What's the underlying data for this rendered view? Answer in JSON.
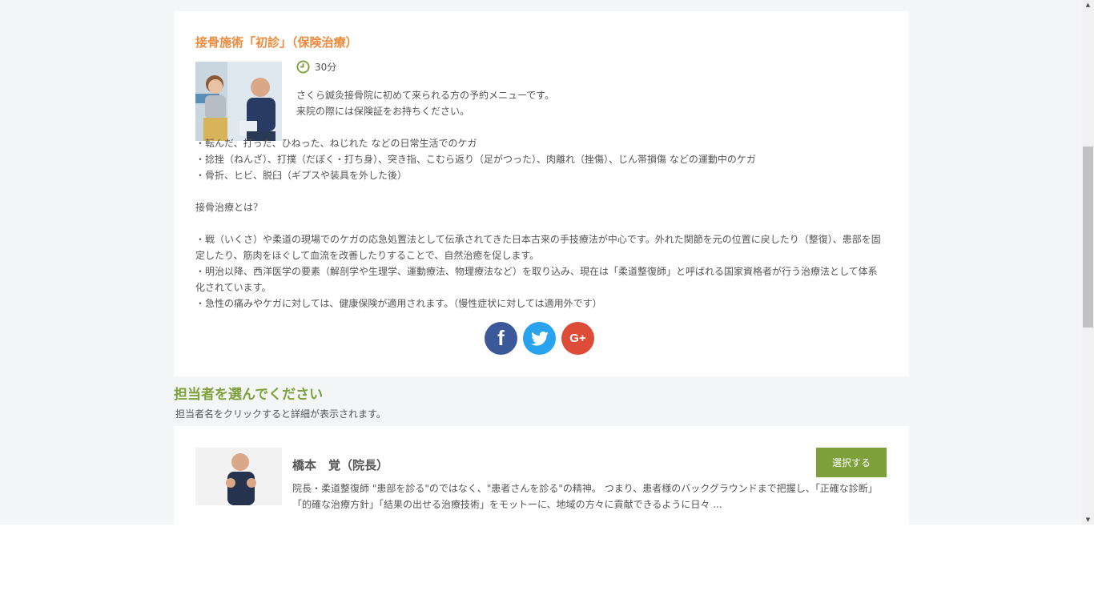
{
  "menu": {
    "title": "接骨施術「初診」（保険治療）",
    "duration": "30分",
    "intro": "さくら鍼灸接骨院に初めて来られる方の予約メニューです。\n来院の際には保険証をお持ちください。",
    "details": "・転んだ、打った、ひねった、ねじれた などの日常生活でのケガ\n・捻挫（ねんざ）、打撲（だぼく・打ち身）、突き指、こむら返り（足がつった）、肉離れ（挫傷）、じん帯損傷 などの運動中のケガ\n・骨折、ヒビ、脱臼（ギプスや装具を外した後）\n\n接骨治療とは？\n\n・戦（いくさ）や柔道の現場でのケガの応急処置法として伝承されてきた日本古来の手技療法が中心です。外れた関節を元の位置に戻したり（整復）、患部を固定したり、筋肉をほぐして血流を改善したりすることで、自然治癒を促します。\n・明治以降、西洋医学の要素（解剖学や生理学、運動療法、物理療法など）を取り込み、現在は「柔道整復師」と呼ばれる国家資格者が行う治療法として体系化されています。\n・急性の痛みやケガに対しては、健康保険が適用されます。（慢性症状に対しては適用外です）",
    "share": {
      "facebook_icon": "facebook-icon",
      "twitter_icon": "twitter-icon",
      "googleplus_label": "G+"
    }
  },
  "staff_section": {
    "title": "担当者を選んでください",
    "note": "担当者名をクリックすると詳細が表示されます。"
  },
  "staff": [
    {
      "name": "橋本　覚（院長）",
      "description": "院長・柔道整復師 \"患部を診る\"のではなく、\"患者さんを診る\"の精神。 つまり、患者様のバックグラウンドまで把握し、「正確な診断」「的確な治療方針」「結果の出せる治療技術」をモットーに、地域の方々に貢献できるように日々 ...",
      "select_label": "選択する"
    }
  ],
  "colors": {
    "accent_orange": "#f08a3c",
    "accent_green": "#7ea03a",
    "facebook": "#3b5998",
    "twitter": "#2aa3ef",
    "googleplus": "#dd4b39"
  }
}
